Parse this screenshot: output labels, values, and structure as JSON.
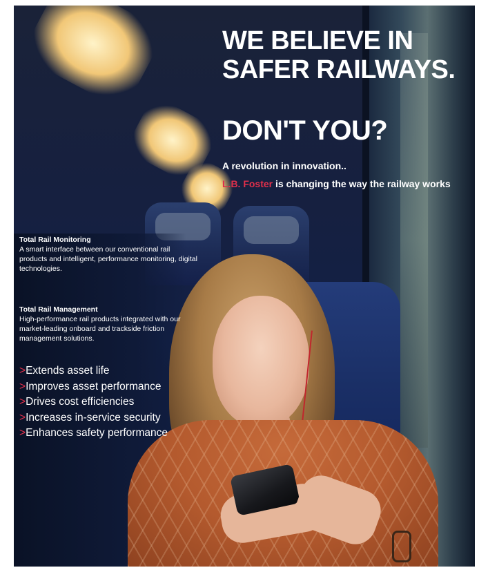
{
  "headline": {
    "line1": "WE BELIEVE IN",
    "line2": "SAFER RAILWAYS.",
    "line3": "DON'T YOU?"
  },
  "tagline": {
    "line1": "A revolution in innovation..",
    "brand": "L.B. Foster",
    "line2_rest": " is changing the way the railway works"
  },
  "sections": [
    {
      "title": "Total Rail Monitoring",
      "body": "A smart interface between our conventional rail products and intelligent, performance monitoring, digital technologies."
    },
    {
      "title": "Total Rail Management",
      "body": "High-performance rail products integrated with our market-leading onboard and trackside friction management solutions."
    }
  ],
  "bullets": {
    "marker": ">",
    "items": [
      "Extends asset life",
      "Improves asset performance",
      "Drives cost efficiencies",
      "Increases in-service security",
      "Enhances safety performance"
    ]
  },
  "colors": {
    "accent": "#e0304b",
    "text": "#ffffff",
    "background": "#162040"
  }
}
